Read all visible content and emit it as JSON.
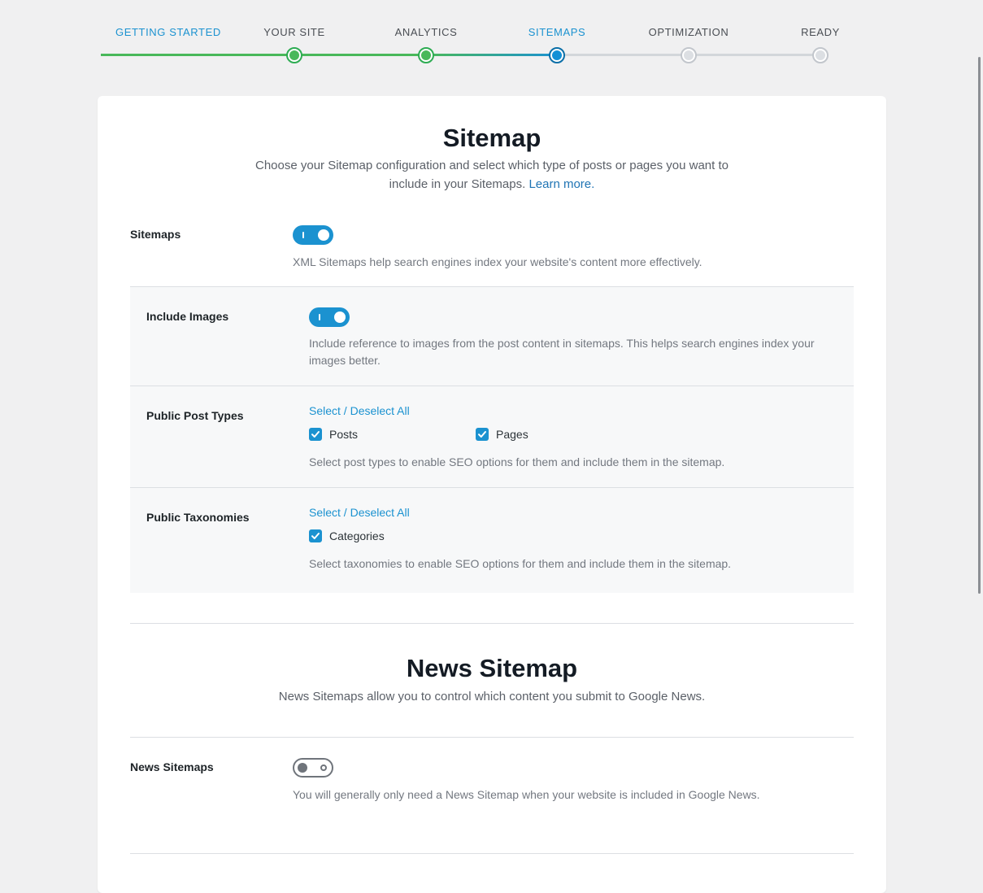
{
  "steps": [
    {
      "label": "Getting Started",
      "state": "done"
    },
    {
      "label": "Your Site",
      "state": "done"
    },
    {
      "label": "Analytics",
      "state": "done"
    },
    {
      "label": "Sitemaps",
      "state": "current"
    },
    {
      "label": "Optimization",
      "state": "todo"
    },
    {
      "label": "Ready",
      "state": "todo"
    }
  ],
  "sitemap": {
    "title": "Sitemap",
    "description": "Choose your Sitemap configuration and select which type of posts or pages you want to include in your Sitemaps.",
    "learn_more": "Learn more.",
    "sitemaps_label": "Sitemaps",
    "sitemaps_help": "XML Sitemaps help search engines index your website's content more effectively.",
    "include_images_label": "Include Images",
    "include_images_help": "Include reference to images from the post content in sitemaps. This helps search engines index your images better.",
    "post_types_label": "Public Post Types",
    "post_types_select_all": "Select / Deselect All",
    "post_types": [
      {
        "label": "Posts",
        "checked": true
      },
      {
        "label": "Pages",
        "checked": true
      }
    ],
    "post_types_help": "Select post types to enable SEO options for them and include them in the sitemap.",
    "taxonomies_label": "Public Taxonomies",
    "taxonomies_select_all": "Select / Deselect All",
    "taxonomies": [
      {
        "label": "Categories",
        "checked": true
      }
    ],
    "taxonomies_help": "Select taxonomies to enable SEO options for them and include them in the sitemap."
  },
  "news": {
    "title": "News Sitemap",
    "description": "News Sitemaps allow you to control which content you submit to Google News.",
    "label": "News Sitemaps",
    "help": "You will generally only need a News Sitemap when your website is included in Google News."
  },
  "colors": {
    "accent": "#1b92d0",
    "done": "#49b85a",
    "todo": "#dcdfe3"
  }
}
